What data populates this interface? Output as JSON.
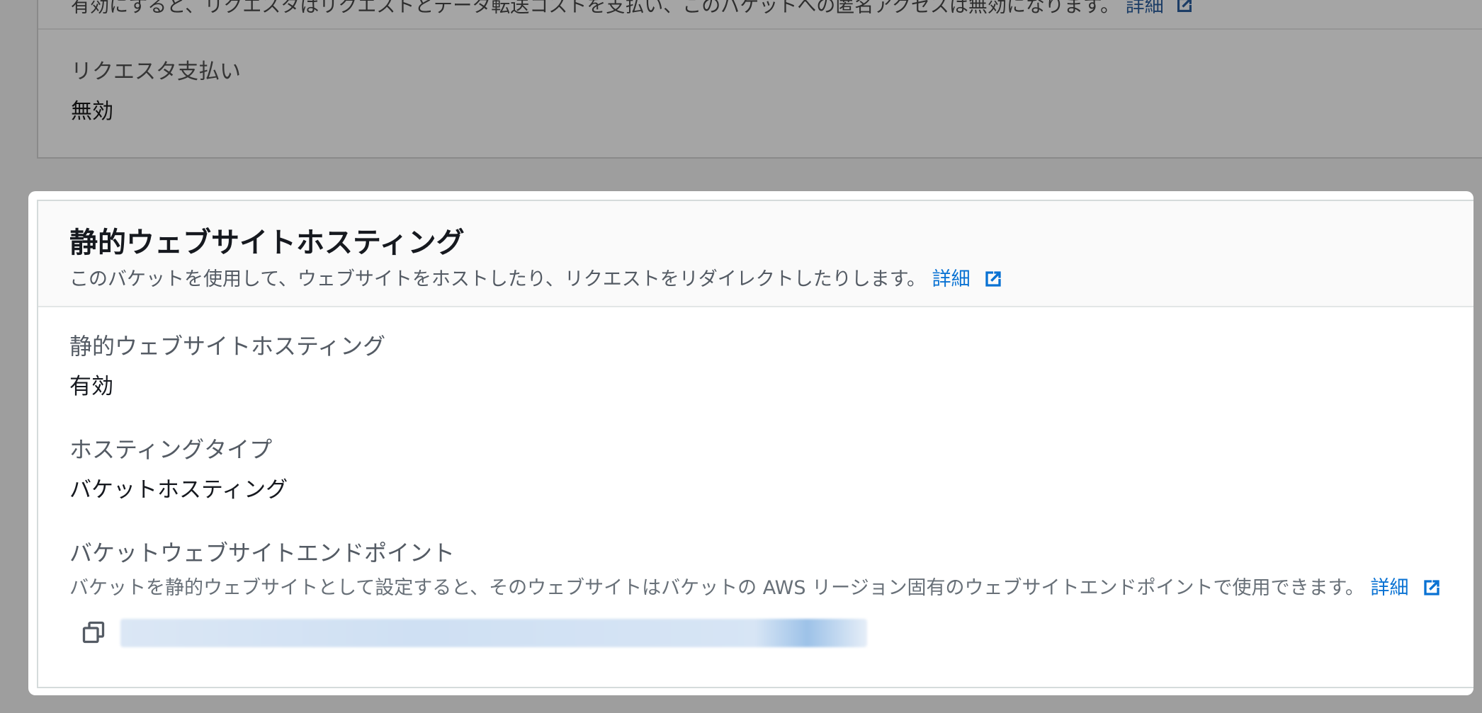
{
  "previous_section": {
    "description": "有効にすると、リクエスタはリクエストとデータ転送コストを支払い、このバケットへの匿名アクセスは無効になります。",
    "learn_more": "詳細",
    "requester_pays_label": "リクエスタ支払い",
    "requester_pays_value": "無効"
  },
  "static_hosting": {
    "title": "静的ウェブサイトホスティング",
    "description": "このバケットを使用して、ウェブサイトをホストしたり、リクエストをリダイレクトしたりします。",
    "learn_more": "詳細",
    "hosting_label": "静的ウェブサイトホスティング",
    "hosting_value": "有効",
    "hosting_type_label": "ホスティングタイプ",
    "hosting_type_value": "バケットホスティング",
    "endpoint_label": "バケットウェブサイトエンドポイント",
    "endpoint_description": "バケットを静的ウェブサイトとして設定すると、そのウェブサイトはバケットの AWS リージョン固有のウェブサイトエンドポイントで使用できます。",
    "endpoint_learn_more": "詳細"
  },
  "icons": {
    "external_link": "external-link-icon",
    "copy": "copy-icon"
  },
  "colors": {
    "link": "#0972d3",
    "overlay": "#9e9e9e"
  }
}
